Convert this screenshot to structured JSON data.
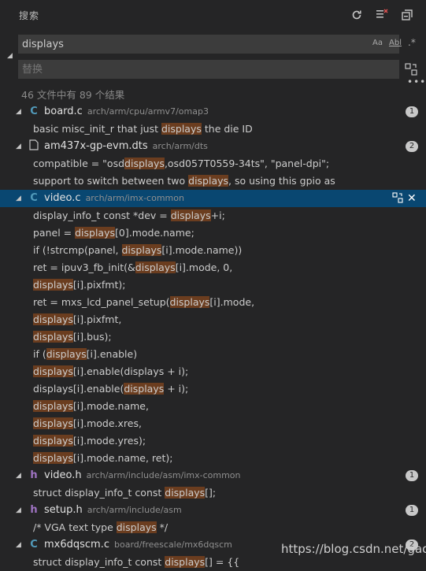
{
  "header": {
    "title": "搜索",
    "refresh_icon": "refresh-icon",
    "clear_icon": "clear-results-icon",
    "collapse_icon": "collapse-all-icon"
  },
  "search": {
    "value": "displays",
    "match_case": "Aa",
    "whole_word": "Abl",
    "regex": ".*"
  },
  "replace": {
    "placeholder": "替换"
  },
  "summary": "46 文件中有 89 个结果",
  "colors": {
    "background": "#252526",
    "selection": "#094771",
    "highlight": "#6b3d1f",
    "c_icon": "#519aba",
    "h_icon": "#a074c4"
  },
  "files": [
    {
      "name": "board.c",
      "path": "arch/arm/cpu/armv7/omap3",
      "icon": "c-file-icon",
      "count": "1",
      "selected": false,
      "matches": [
        [
          "basic misc_init_r that just ",
          "displays",
          " the die ID"
        ]
      ]
    },
    {
      "name": "am437x-gp-evm.dts",
      "path": "arch/arm/dts",
      "icon": "generic-file-icon",
      "count": "2",
      "selected": false,
      "matches": [
        [
          "compatible = \"osd",
          "displays",
          ",osd057T0559-34ts\", \"panel-dpi\";"
        ],
        [
          "support to switch between two ",
          "displays",
          ", so using this gpio as"
        ]
      ]
    },
    {
      "name": "video.c",
      "path": "arch/arm/imx-common",
      "icon": "c-file-icon",
      "count": "",
      "selected": true,
      "matches": [
        [
          "display_info_t const *dev = ",
          "displays",
          "+i;"
        ],
        [
          "panel = ",
          "displays",
          "[0].mode.name;"
        ],
        [
          "if (!strcmp(panel, ",
          "displays",
          "[i].mode.name))"
        ],
        [
          "ret = ipuv3_fb_init(&",
          "displays",
          "[i].mode, 0,"
        ],
        [
          "",
          "displays",
          "[i].pixfmt);"
        ],
        [
          "ret = mxs_lcd_panel_setup(",
          "displays",
          "[i].mode,"
        ],
        [
          "",
          "displays",
          "[i].pixfmt,"
        ],
        [
          "",
          "displays",
          "[i].bus);"
        ],
        [
          "if (",
          "displays",
          "[i].enable)"
        ],
        [
          "",
          "displays",
          "[i].enable(displays + i);"
        ],
        [
          "displays[i].enable(",
          "displays",
          " + i);"
        ],
        [
          "",
          "displays",
          "[i].mode.name,"
        ],
        [
          "",
          "displays",
          "[i].mode.xres,"
        ],
        [
          "",
          "displays",
          "[i].mode.yres);"
        ],
        [
          "",
          "displays",
          "[i].mode.name, ret);"
        ]
      ]
    },
    {
      "name": "video.h",
      "path": "arch/arm/include/asm/imx-common",
      "icon": "h-file-icon",
      "count": "1",
      "selected": false,
      "matches": [
        [
          "struct display_info_t const ",
          "displays",
          "[];"
        ]
      ]
    },
    {
      "name": "setup.h",
      "path": "arch/arm/include/asm",
      "icon": "h-file-icon",
      "count": "1",
      "selected": false,
      "matches": [
        [
          "/* VGA text type ",
          "displays",
          " */"
        ]
      ]
    },
    {
      "name": "mx6dqscm.c",
      "path": "board/freescale/mx6dqscm",
      "icon": "c-file-icon",
      "count": "2",
      "selected": false,
      "matches": [
        [
          "struct display_info_t const ",
          "displays",
          "[] = {{"
        ]
      ]
    }
  ],
  "watermark": "https://blog.csdn.net/gaoj"
}
